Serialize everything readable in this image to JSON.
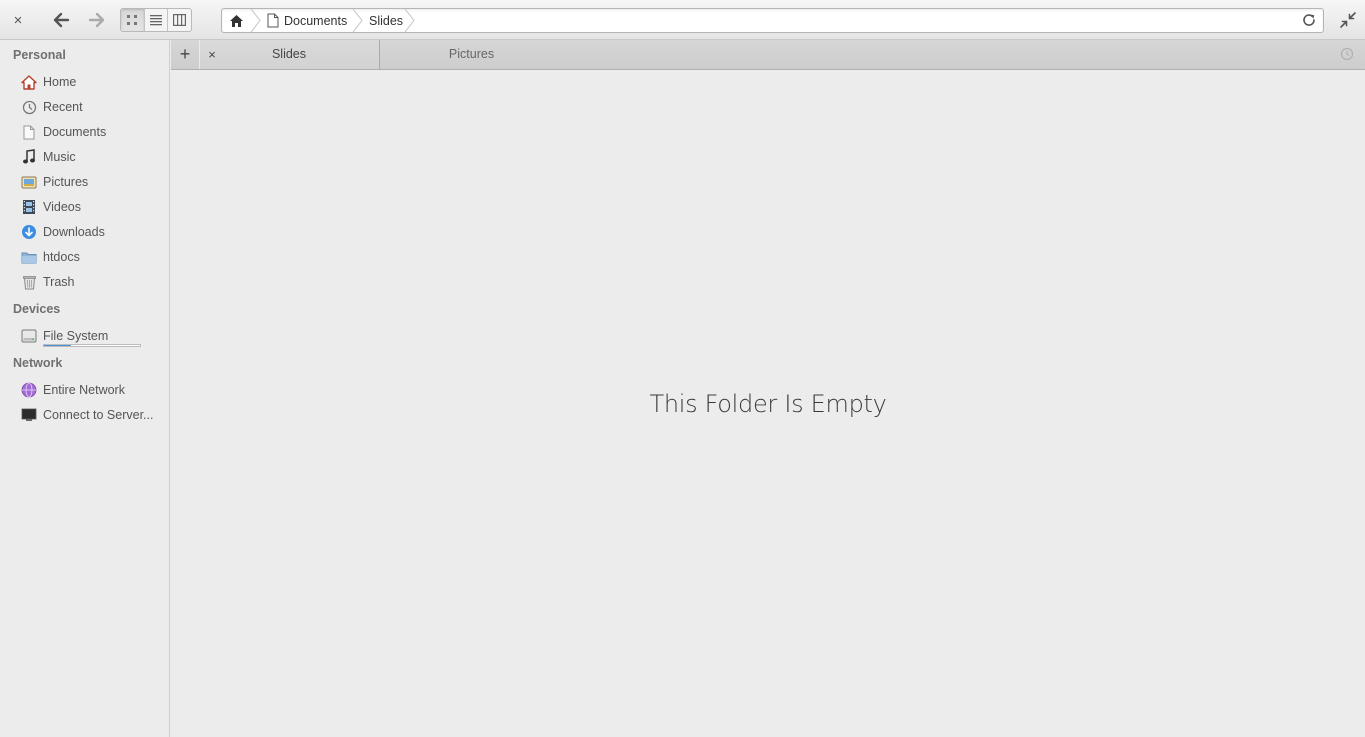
{
  "header": {
    "close_glyph": "×",
    "back_icon": "go-previous-icon",
    "forward_icon": "go-next-icon",
    "view_modes": [
      "icon-view",
      "list-view",
      "column-view"
    ],
    "active_view": "icon-view",
    "breadcrumbs": [
      "Documents",
      "Slides"
    ],
    "refresh_icon": "refresh-icon",
    "restore_icon": "window-restore-icon"
  },
  "sidebar": {
    "personal_heading": "Personal",
    "personal": [
      {
        "label": "Home",
        "icon": "home-icon"
      },
      {
        "label": "Recent",
        "icon": "recent-icon"
      },
      {
        "label": "Documents",
        "icon": "document-icon"
      },
      {
        "label": "Music",
        "icon": "music-icon"
      },
      {
        "label": "Pictures",
        "icon": "pictures-icon"
      },
      {
        "label": "Videos",
        "icon": "video-icon"
      },
      {
        "label": "Downloads",
        "icon": "downloads-icon"
      },
      {
        "label": "htdocs",
        "icon": "folder-icon"
      },
      {
        "label": "Trash",
        "icon": "trash-icon"
      }
    ],
    "devices_heading": "Devices",
    "devices": [
      {
        "label": "File System",
        "icon": "harddisk-icon",
        "usage_fraction": 0.28
      }
    ],
    "network_heading": "Network",
    "network": [
      {
        "label": "Entire Network",
        "icon": "network-icon"
      },
      {
        "label": "Connect to Server...",
        "icon": "server-icon"
      }
    ]
  },
  "tabs": {
    "new_tab_glyph": "+",
    "close_glyph": "×",
    "items": [
      {
        "label": "Slides",
        "active": true
      },
      {
        "label": "Pictures",
        "active": false
      }
    ]
  },
  "content": {
    "empty_message": "This Folder Is Empty"
  },
  "colors": {
    "accent": "#4a90d9",
    "home_icon": "#c0392b",
    "downloads_icon": "#3d8de0",
    "network_icon": "#9b59d6"
  }
}
